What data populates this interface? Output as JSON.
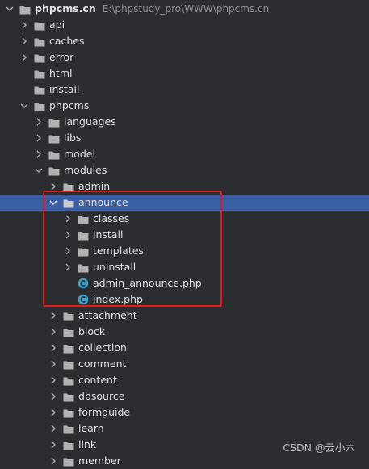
{
  "project_tree": {
    "root": {
      "label": "phpcms.cn",
      "path": "E:\\phpstudy_pro\\WWW\\phpcms.cn"
    },
    "items": [
      {
        "label": "api",
        "depth": 1,
        "type": "folder",
        "chevron": "right"
      },
      {
        "label": "caches",
        "depth": 1,
        "type": "folder",
        "chevron": "right"
      },
      {
        "label": "error",
        "depth": 1,
        "type": "folder",
        "chevron": "right"
      },
      {
        "label": "html",
        "depth": 1,
        "type": "folder",
        "chevron": "none"
      },
      {
        "label": "install",
        "depth": 1,
        "type": "folder",
        "chevron": "none"
      },
      {
        "label": "phpcms",
        "depth": 1,
        "type": "folder",
        "chevron": "down"
      },
      {
        "label": "languages",
        "depth": 2,
        "type": "folder",
        "chevron": "right"
      },
      {
        "label": "libs",
        "depth": 2,
        "type": "folder",
        "chevron": "right"
      },
      {
        "label": "model",
        "depth": 2,
        "type": "folder",
        "chevron": "right"
      },
      {
        "label": "modules",
        "depth": 2,
        "type": "folder",
        "chevron": "down"
      },
      {
        "label": "admin",
        "depth": 3,
        "type": "folder",
        "chevron": "right"
      },
      {
        "label": "announce",
        "depth": 3,
        "type": "folder",
        "chevron": "down",
        "selected": true
      },
      {
        "label": "classes",
        "depth": 4,
        "type": "folder",
        "chevron": "right"
      },
      {
        "label": "install",
        "depth": 4,
        "type": "folder",
        "chevron": "right"
      },
      {
        "label": "templates",
        "depth": 4,
        "type": "folder",
        "chevron": "right"
      },
      {
        "label": "uninstall",
        "depth": 4,
        "type": "folder",
        "chevron": "right"
      },
      {
        "label": "admin_announce.php",
        "depth": 4,
        "type": "php",
        "chevron": "none"
      },
      {
        "label": "index.php",
        "depth": 4,
        "type": "php",
        "chevron": "none"
      },
      {
        "label": "attachment",
        "depth": 3,
        "type": "folder",
        "chevron": "right"
      },
      {
        "label": "block",
        "depth": 3,
        "type": "folder",
        "chevron": "right"
      },
      {
        "label": "collection",
        "depth": 3,
        "type": "folder",
        "chevron": "right"
      },
      {
        "label": "comment",
        "depth": 3,
        "type": "folder",
        "chevron": "right"
      },
      {
        "label": "content",
        "depth": 3,
        "type": "folder",
        "chevron": "right"
      },
      {
        "label": "dbsource",
        "depth": 3,
        "type": "folder",
        "chevron": "right"
      },
      {
        "label": "formguide",
        "depth": 3,
        "type": "folder",
        "chevron": "right"
      },
      {
        "label": "learn",
        "depth": 3,
        "type": "folder",
        "chevron": "right"
      },
      {
        "label": "link",
        "depth": 3,
        "type": "folder",
        "chevron": "right"
      },
      {
        "label": "member",
        "depth": 3,
        "type": "folder",
        "chevron": "right"
      }
    ]
  },
  "watermark": "CSDN @云小六",
  "colors": {
    "background": "#2b2d30",
    "selection": "#3a5ea3",
    "folder_icon": "#afb1b3",
    "php_icon": "#3ba0c8",
    "annotation_box": "#e21c1c",
    "path_text": "#8c8f94"
  }
}
